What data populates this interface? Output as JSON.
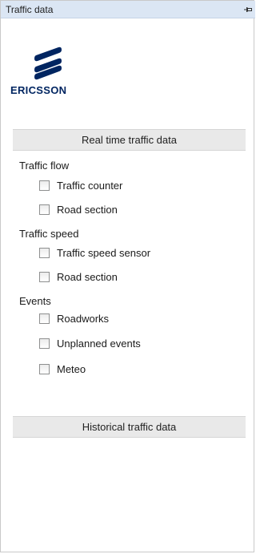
{
  "panel": {
    "title": "Traffic data"
  },
  "logo": {
    "wordmark": "ERICSSON",
    "brand_color": "#002561"
  },
  "realtime": {
    "header": "Real time traffic data",
    "groups": [
      {
        "label": "Traffic flow",
        "items": [
          {
            "label": "Traffic counter",
            "checked": false
          },
          {
            "label": "Road section",
            "checked": false
          }
        ]
      },
      {
        "label": "Traffic speed",
        "items": [
          {
            "label": "Traffic speed sensor",
            "checked": false
          },
          {
            "label": "Road section",
            "checked": false
          }
        ]
      },
      {
        "label": "Events",
        "items": [
          {
            "label": "Roadworks",
            "checked": false
          },
          {
            "label": "Unplanned events",
            "checked": false
          },
          {
            "label": "Meteo",
            "checked": false
          }
        ]
      }
    ]
  },
  "historical": {
    "header": "Historical traffic data"
  },
  "icons": {
    "pin": "pin-icon",
    "logo": "ericsson-logo"
  }
}
